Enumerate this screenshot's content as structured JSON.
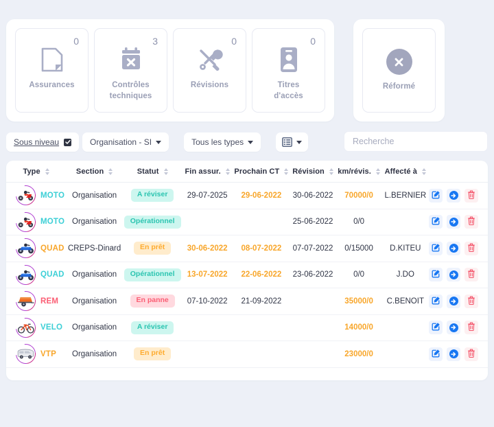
{
  "stats": {
    "cards": [
      {
        "label_line1": "Assurances",
        "label_line2": "",
        "count": "0",
        "icon": "document-icon"
      },
      {
        "label_line1": "Contrôles",
        "label_line2": "techniques",
        "count": "3",
        "icon": "calendar-x-icon"
      },
      {
        "label_line1": "Révisions",
        "label_line2": "",
        "count": "0",
        "icon": "tools-icon"
      },
      {
        "label_line1": "Titres",
        "label_line2": "d'accès",
        "count": "0",
        "icon": "id-badge-icon"
      }
    ],
    "reformed": {
      "label": "Réformé",
      "icon": "circle-x-icon"
    }
  },
  "filters": {
    "sub_level_label": "Sous niveau",
    "sub_level_checked": true,
    "organisation_label": "Organisation - SI",
    "types_label": "Tous les types",
    "view_icon": "table-view-icon"
  },
  "search": {
    "placeholder": "Recherche",
    "value": ""
  },
  "table": {
    "columns": [
      {
        "label": "Type",
        "sortable": true
      },
      {
        "label": "Section",
        "sortable": true
      },
      {
        "label": "Statut",
        "sortable": true
      },
      {
        "label": "Fin assur.",
        "sortable": true
      },
      {
        "label": "Prochain CT",
        "sortable": true
      },
      {
        "label": "Révision",
        "sortable": true
      },
      {
        "label": "km/révis.",
        "sortable": true
      },
      {
        "label": "Affecté à",
        "sortable": true
      },
      {
        "label": "",
        "sortable": false
      }
    ],
    "rows": [
      {
        "type": "MOTO",
        "type_color": "#3ccfd6",
        "vehicle_icon": "motorbike-red-icon",
        "section": "Organisation",
        "status": "A réviser",
        "status_class": "b-reviser",
        "fin_assur": "29-07-2025",
        "fin_assur_class": "dark",
        "prochain_ct": "29-06-2022",
        "prochain_ct_class": "orange",
        "revision": "30-06-2022",
        "revision_class": "dark",
        "km_revis": "70000/0",
        "km_revis_class": "orange",
        "affecte": "L.BERNIER"
      },
      {
        "type": "MOTO",
        "type_color": "#3ccfd6",
        "vehicle_icon": "motorbike-red-icon",
        "section": "Organisation",
        "status": "Opérationnel",
        "status_class": "b-oper",
        "fin_assur": "",
        "fin_assur_class": "dark",
        "prochain_ct": "",
        "prochain_ct_class": "dark",
        "revision": "25-06-2022",
        "revision_class": "dark",
        "km_revis": "0/0",
        "km_revis_class": "dark",
        "affecte": ""
      },
      {
        "type": "QUAD",
        "type_color": "#f8a62a",
        "vehicle_icon": "quad-blue-icon",
        "section": "CREPS-Dinard",
        "status": "En prêt",
        "status_class": "b-pret",
        "fin_assur": "30-06-2022",
        "fin_assur_class": "orange",
        "prochain_ct": "08-07-2022",
        "prochain_ct_class": "orange",
        "revision": "07-07-2022",
        "revision_class": "dark",
        "km_revis": "0/15000",
        "km_revis_class": "dark",
        "affecte": "D.KITEU"
      },
      {
        "type": "QUAD",
        "type_color": "#3ccfd6",
        "vehicle_icon": "quad-blue-icon",
        "section": "Organisation",
        "status": "Opérationnel",
        "status_class": "b-oper",
        "fin_assur": "13-07-2022",
        "fin_assur_class": "orange",
        "prochain_ct": "22-06-2022",
        "prochain_ct_class": "orange",
        "revision": "23-06-2022",
        "revision_class": "dark",
        "km_revis": "0/0",
        "km_revis_class": "dark",
        "affecte": "J.DO"
      },
      {
        "type": "REM",
        "type_color": "#fb5e74",
        "vehicle_icon": "trailer-orange-icon",
        "section": "Organisation",
        "status": "En panne",
        "status_class": "b-panne",
        "fin_assur": "07-10-2022",
        "fin_assur_class": "dark",
        "prochain_ct": "21-09-2022",
        "prochain_ct_class": "dark",
        "revision": "",
        "revision_class": "dark",
        "km_revis": "35000/0",
        "km_revis_class": "orange",
        "affecte": "C.BENOIT"
      },
      {
        "type": "VELO",
        "type_color": "#3ccfd6",
        "vehicle_icon": "bicycle-icon",
        "section": "Organisation",
        "status": "A réviser",
        "status_class": "b-reviser",
        "fin_assur": "",
        "fin_assur_class": "dark",
        "prochain_ct": "",
        "prochain_ct_class": "dark",
        "revision": "",
        "revision_class": "dark",
        "km_revis": "14000/0",
        "km_revis_class": "orange",
        "affecte": ""
      },
      {
        "type": "VTP",
        "type_color": "#f8a62a",
        "vehicle_icon": "minibus-icon",
        "section": "Organisation",
        "status": "En prêt",
        "status_class": "b-pret",
        "fin_assur": "",
        "fin_assur_class": "dark",
        "prochain_ct": "",
        "prochain_ct_class": "dark",
        "revision": "",
        "revision_class": "dark",
        "km_revis": "23000/0",
        "km_revis_class": "orange",
        "affecte": ""
      }
    ],
    "row_actions": [
      {
        "name": "edit-button",
        "icon": "pencil-square-icon"
      },
      {
        "name": "detail-button",
        "icon": "arrow-right-circle-icon"
      },
      {
        "name": "delete-button",
        "icon": "trash-icon"
      }
    ]
  },
  "colors": {
    "page_bg": "#edf0f7",
    "accent_blue": "#1877f2",
    "accent_orange": "#f8a62a",
    "accent_teal": "#2bc4b0",
    "accent_red": "#fb5e74",
    "muted": "#9a9fb5"
  }
}
